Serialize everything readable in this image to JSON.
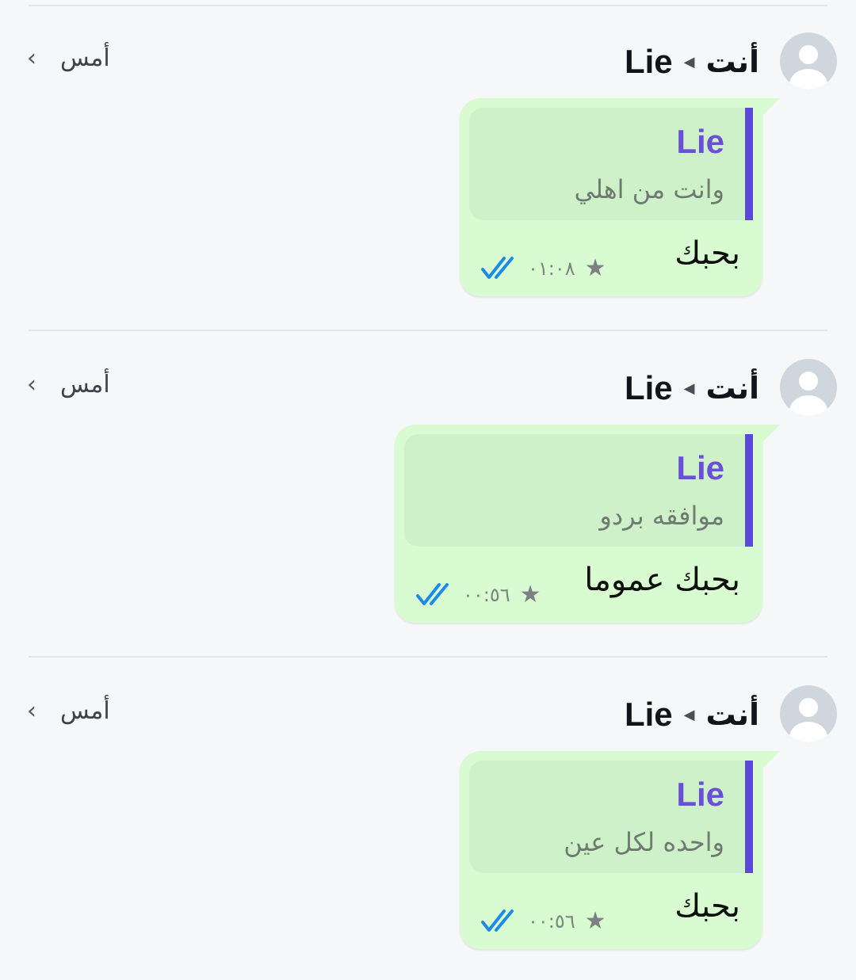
{
  "items": [
    {
      "sender": "أنت",
      "contact": "Lie",
      "date": "أمس",
      "quoted_name": "Lie",
      "quoted_text": "وانت من اهلي",
      "message": "بحبك",
      "time": "٠١:٠٨",
      "starred": true
    },
    {
      "sender": "أنت",
      "contact": "Lie",
      "date": "أمس",
      "quoted_name": "Lie",
      "quoted_text": "موافقه بردو",
      "message": "بحبك عموما",
      "time": "٠٠:٥٦",
      "starred": true
    },
    {
      "sender": "أنت",
      "contact": "Lie",
      "date": "أمس",
      "quoted_name": "Lie",
      "quoted_text": "واحده لكل عين",
      "message": "بحبك",
      "time": "٠٠:٥٦",
      "starred": true
    }
  ],
  "icons": {
    "avatar": "default-avatar-icon",
    "chevron": "chevron-left-icon",
    "arrow": "left-triangle-icon",
    "star": "star-icon",
    "ticks": "double-check-read-icon"
  },
  "colors": {
    "background": "#f6f7f9",
    "bubble": "#d8fbd2",
    "quote_bg": "#cef1c9",
    "quote_bar": "#5b48d6",
    "quote_name": "#6a50d8",
    "read_ticks": "#1a8ce5"
  }
}
